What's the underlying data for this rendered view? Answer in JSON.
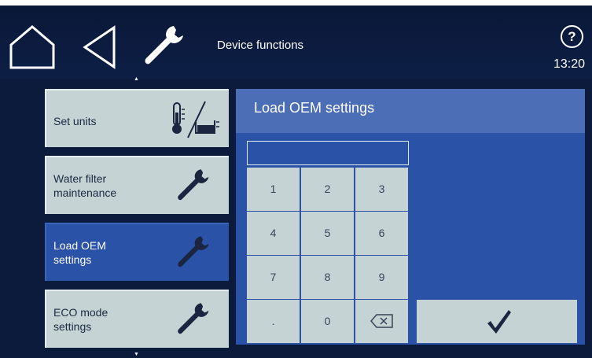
{
  "header": {
    "title": "Device functions",
    "time": "13:20",
    "help_label": "?"
  },
  "menu": {
    "items": [
      {
        "label": "Set units",
        "icon": "thermometer-tank-icon",
        "active": false
      },
      {
        "label": "Water filter maintenance",
        "icon": "wrench-icon",
        "active": false
      },
      {
        "label": "Load OEM settings",
        "icon": "wrench-icon",
        "active": true
      },
      {
        "label": "ECO mode settings",
        "icon": "wrench-icon",
        "active": false
      }
    ]
  },
  "panel": {
    "title": "Load OEM settings",
    "input_value": "",
    "keys": [
      "1",
      "2",
      "3",
      "4",
      "5",
      "6",
      "7",
      "8",
      "9",
      ".",
      "0"
    ],
    "confirm_icon": "checkmark-icon",
    "backspace_icon": "backspace-icon"
  },
  "colors": {
    "header_bg": "#0a1737",
    "tile_bg": "#c6d3d5",
    "active_blue": "#2a52a7",
    "panel_header": "#4b6eb6"
  }
}
